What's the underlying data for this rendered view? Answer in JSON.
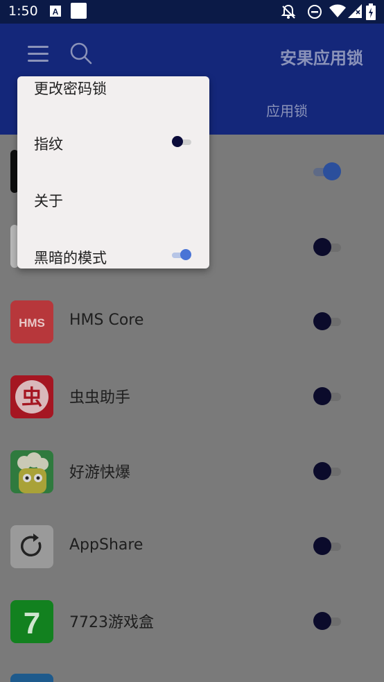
{
  "status_bar": {
    "time": "1:50",
    "icons": [
      "keyboard-a-icon",
      "white-square-icon",
      "notification-off-icon",
      "do-not-disturb-icon",
      "wifi-icon",
      "signal-icon",
      "battery-icon"
    ]
  },
  "app_bar": {
    "title": "安果应用锁",
    "tab_label": "应用锁",
    "menu_icon": "hamburger-menu-icon",
    "search_icon": "search-icon"
  },
  "popup_menu": {
    "items": [
      {
        "label": "更改密码锁"
      },
      {
        "label": "指纹",
        "toggle": "off"
      },
      {
        "label": "关于"
      },
      {
        "label": "黑暗的模式",
        "toggle": "on"
      }
    ]
  },
  "apps": [
    {
      "name": "",
      "toggle": "on"
    },
    {
      "name": "",
      "toggle": "off"
    },
    {
      "name": "HMS Core",
      "toggle": "off",
      "icon_text": "HMS"
    },
    {
      "name": "虫虫助手",
      "toggle": "off",
      "icon_text": "虫"
    },
    {
      "name": "好游快爆",
      "toggle": "off"
    },
    {
      "name": "AppShare",
      "toggle": "off"
    },
    {
      "name": "7723游戏盒",
      "toggle": "off",
      "icon_text": "7"
    }
  ],
  "colors": {
    "status_bar": "#0b1a47",
    "app_bar": "#14277a",
    "scrim_bg": "#7a7a7a",
    "accent": "#4a74d6",
    "popup_bg": "#f2efef"
  }
}
